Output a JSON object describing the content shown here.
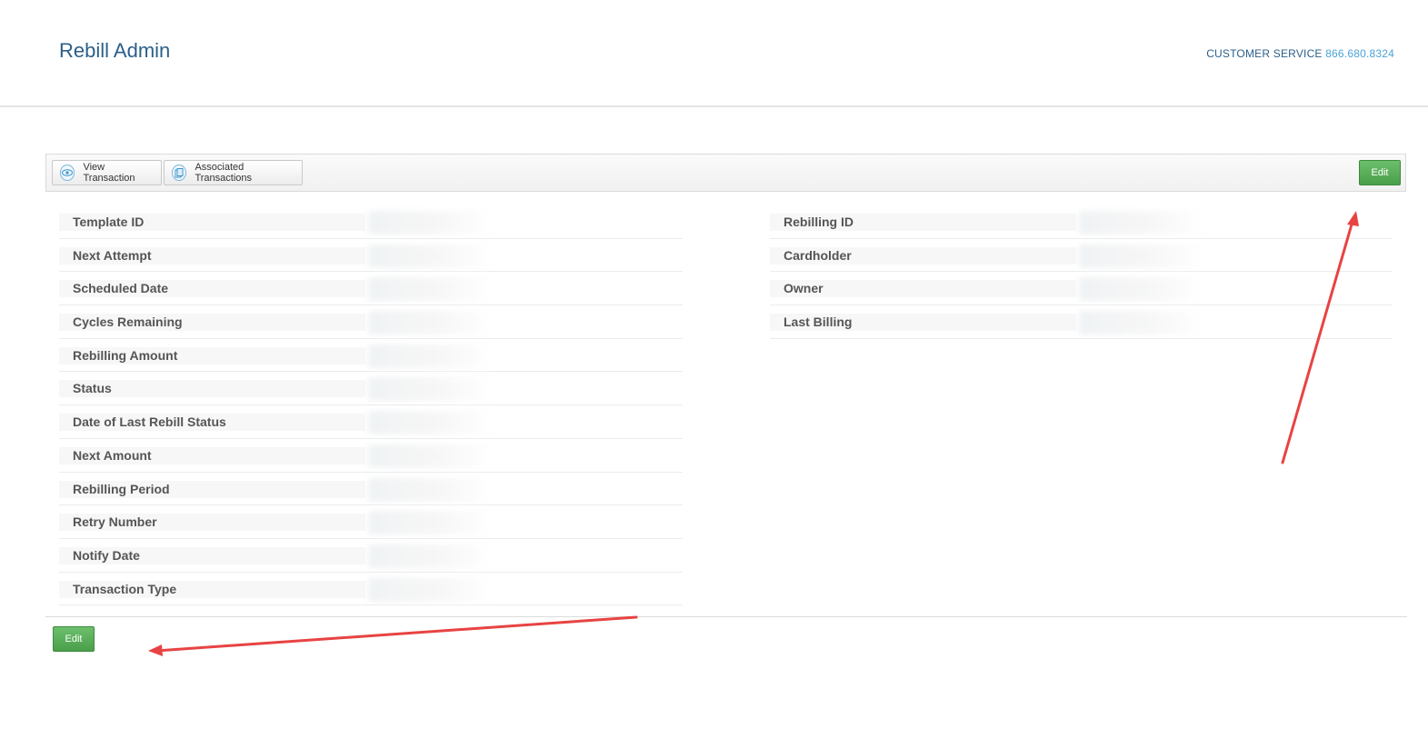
{
  "header": {
    "title": "Rebill Admin",
    "customer_service_label": "CUSTOMER SERVICE",
    "customer_service_phone": "866.680.8324"
  },
  "toolbar": {
    "view_transaction_label": "View Transaction",
    "associated_transactions_label": "Associated Transactions",
    "edit_label": "Edit"
  },
  "details_left": [
    {
      "label": "Template ID"
    },
    {
      "label": "Next Attempt"
    },
    {
      "label": "Scheduled Date"
    },
    {
      "label": "Cycles Remaining"
    },
    {
      "label": "Rebilling Amount"
    },
    {
      "label": "Status"
    },
    {
      "label": "Date of Last Rebill Status"
    },
    {
      "label": "Next Amount"
    },
    {
      "label": "Rebilling Period"
    },
    {
      "label": "Retry Number"
    },
    {
      "label": "Notify Date"
    },
    {
      "label": "Transaction Type"
    }
  ],
  "details_right": [
    {
      "label": "Rebilling ID"
    },
    {
      "label": "Cardholder"
    },
    {
      "label": "Owner"
    },
    {
      "label": "Last Billing"
    }
  ],
  "footer": {
    "edit_label": "Edit"
  },
  "colors": {
    "title": "#2b5f8a",
    "phone": "#4aa3d8",
    "edit_button": "#5aad5a",
    "annotation_arrow": "#e84343"
  }
}
